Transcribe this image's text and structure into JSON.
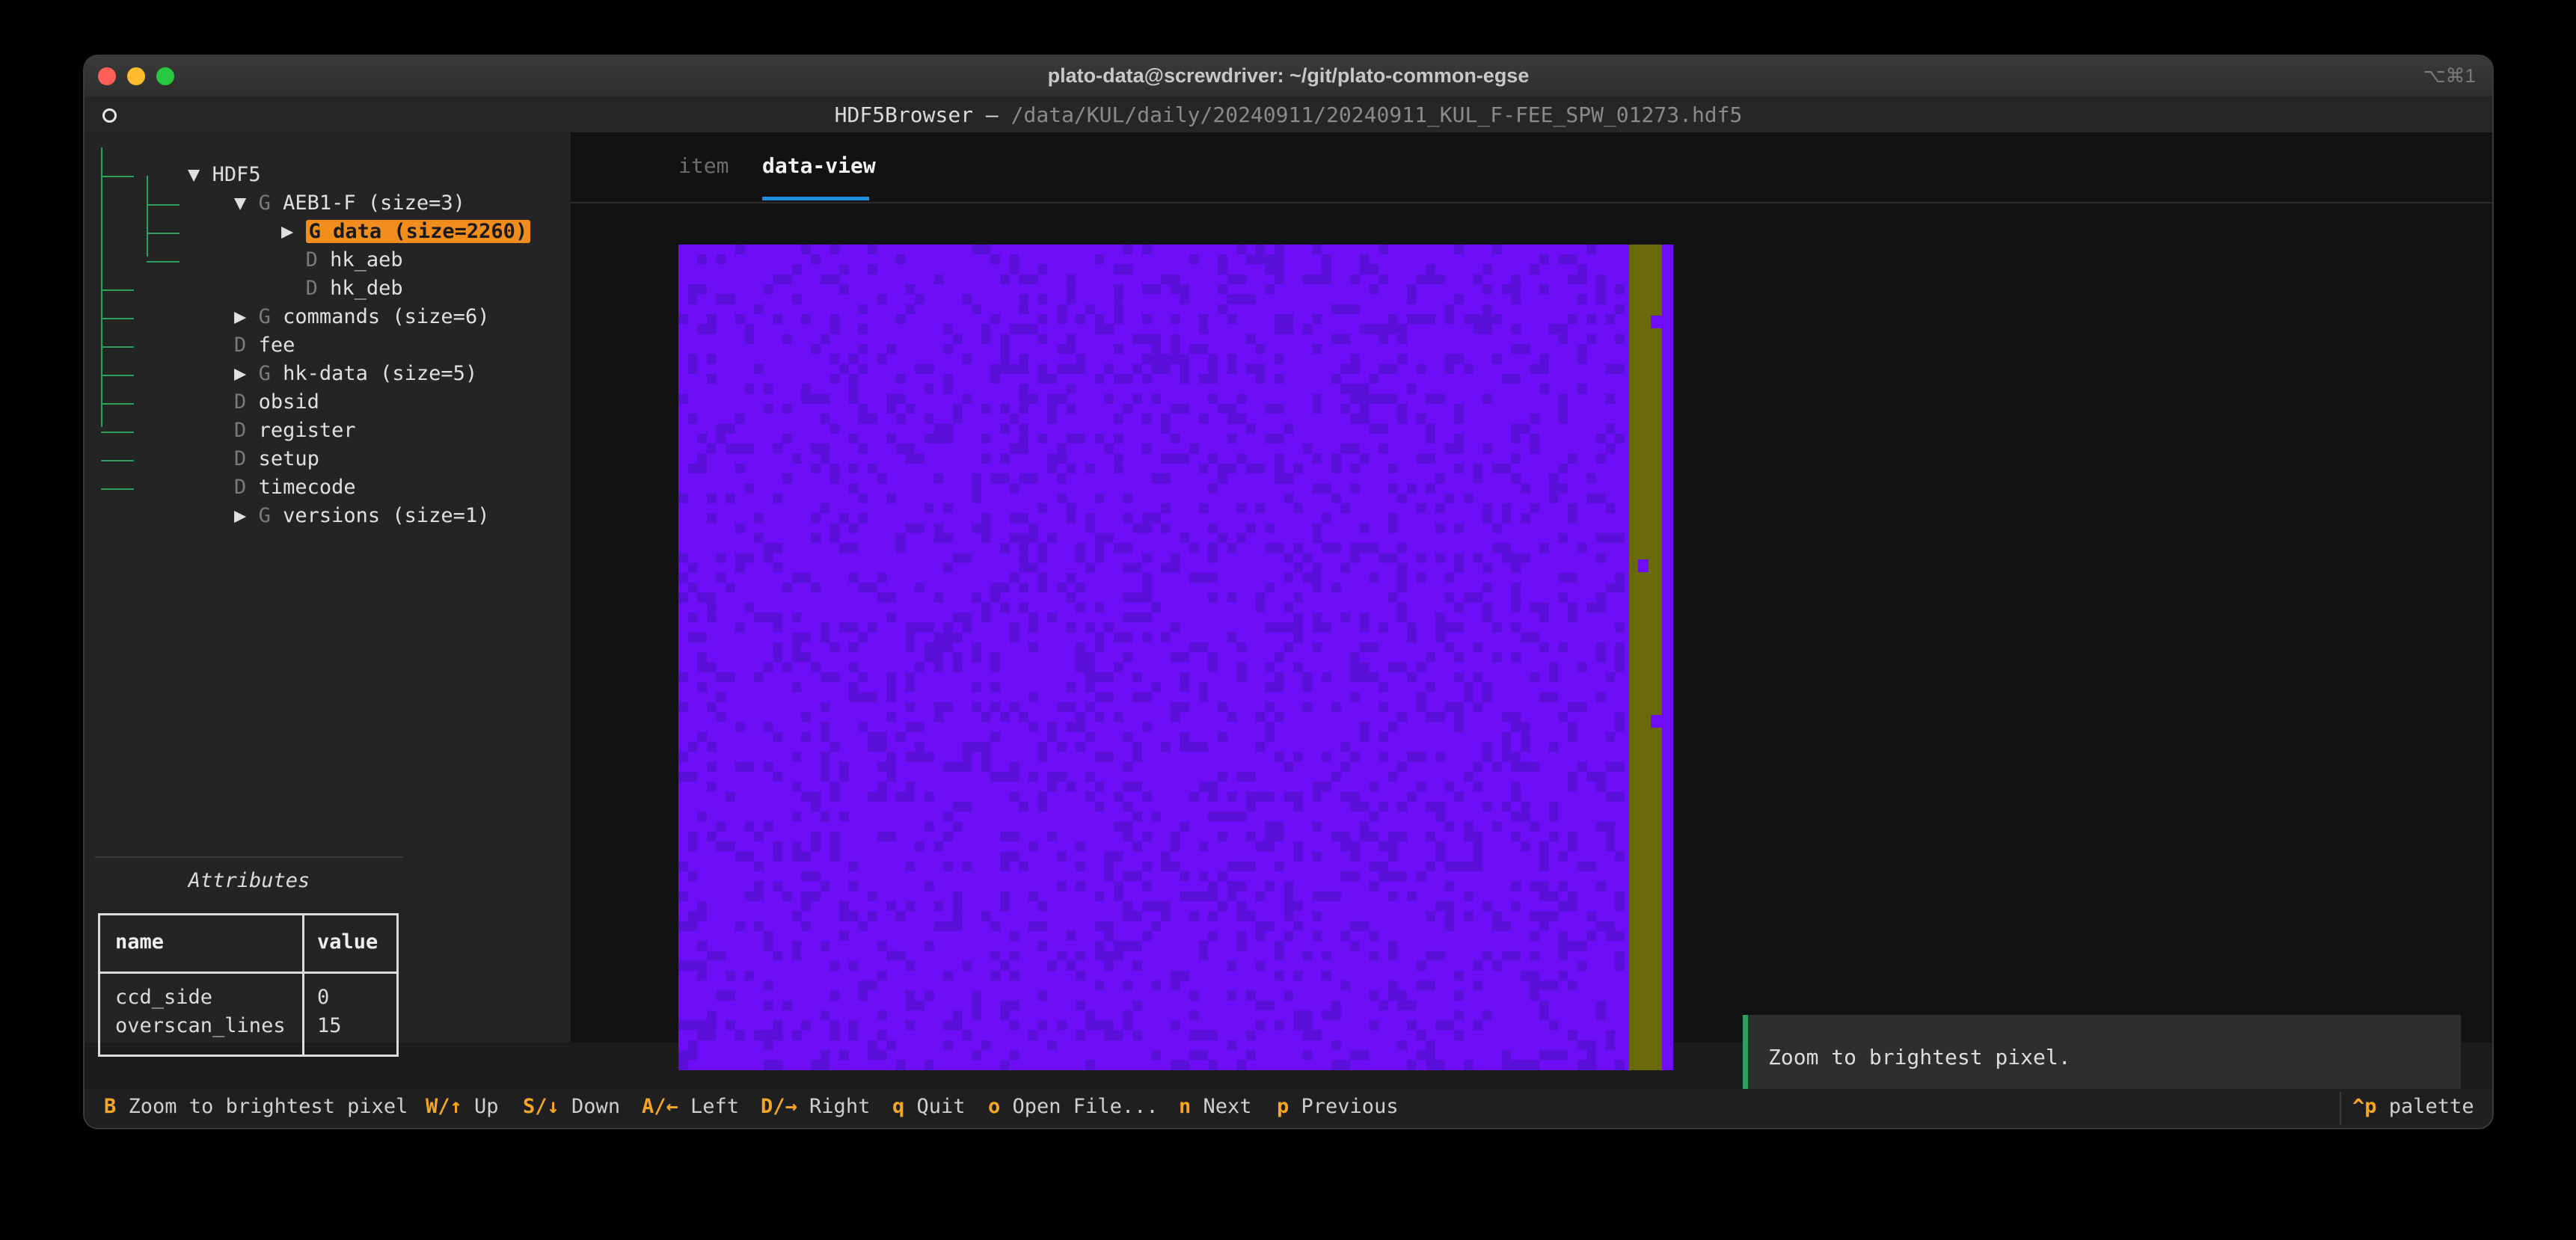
{
  "window": {
    "title": "plato-data@screwdriver: ~/git/plato-common-egse",
    "shortcut": "⌥⌘1"
  },
  "app_header": {
    "app_name": "HDF5Browser",
    "separator": " — ",
    "file_path": "/data/KUL/daily/20240911/20240911_KUL_F-FEE_SPW_01273.hdf5"
  },
  "tree": {
    "root": "HDF5",
    "items": [
      {
        "type": "G",
        "label": "AEB1-F (size=3)",
        "expanded": true
      },
      {
        "type": "G",
        "label": "data (size=2260)",
        "selected": true
      },
      {
        "type": "D",
        "label": "hk_aeb"
      },
      {
        "type": "D",
        "label": "hk_deb"
      },
      {
        "type": "G",
        "label": "commands (size=6)"
      },
      {
        "type": "D",
        "label": "fee"
      },
      {
        "type": "G",
        "label": "hk-data (size=5)"
      },
      {
        "type": "D",
        "label": "obsid"
      },
      {
        "type": "D",
        "label": "register"
      },
      {
        "type": "D",
        "label": "setup"
      },
      {
        "type": "D",
        "label": "timecode"
      },
      {
        "type": "G",
        "label": "versions (size=1)"
      }
    ],
    "expanded_glyph": "▼",
    "collapsed_glyph": "▶"
  },
  "attributes": {
    "title": "Attributes",
    "headers": [
      "name",
      "value"
    ],
    "rows": [
      {
        "name": "ccd_side",
        "value": "0"
      },
      {
        "name": "overscan_lines",
        "value": "15"
      }
    ]
  },
  "tabs": [
    {
      "label": "item",
      "active": false
    },
    {
      "label": "data-view",
      "active": true
    }
  ],
  "heatmap": {
    "colors": {
      "low": "#5a0fd8",
      "base": "#6e0ef6",
      "overscan": "#6a6a0a",
      "edge": "#6e0ef6"
    }
  },
  "toast": {
    "message": "Zoom to brightest pixel."
  },
  "footer": {
    "bindings": [
      {
        "key": "B",
        "desc": "Zoom to brightest pixel"
      },
      {
        "key": "W/↑",
        "desc": "Up"
      },
      {
        "key": "S/↓",
        "desc": "Down"
      },
      {
        "key": "A/←",
        "desc": "Left"
      },
      {
        "key": "D/→",
        "desc": "Right"
      },
      {
        "key": "q",
        "desc": "Quit"
      },
      {
        "key": "o",
        "desc": "Open File..."
      },
      {
        "key": "n",
        "desc": "Next"
      },
      {
        "key": "p",
        "desc": "Previous"
      }
    ],
    "palette": {
      "key": "^p",
      "desc": "palette"
    }
  }
}
